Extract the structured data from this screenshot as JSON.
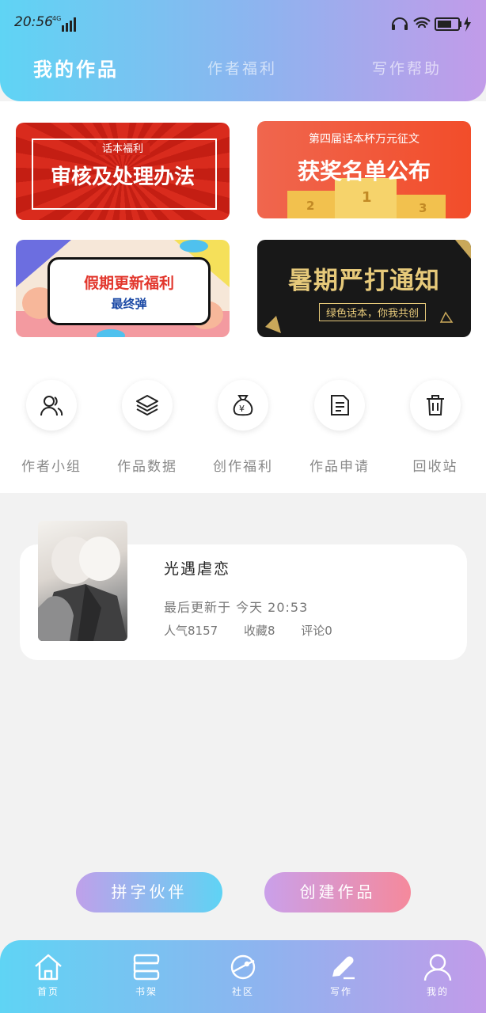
{
  "status_bar": {
    "time": "20:56",
    "network": "4G"
  },
  "header_tabs": [
    {
      "label": "我的作品",
      "active": true
    },
    {
      "label": "作者福利",
      "active": false
    },
    {
      "label": "写作帮助",
      "active": false
    }
  ],
  "banners": [
    {
      "small": "话本福利",
      "big": "审核及处理办法"
    },
    {
      "small": "第四届话本杯万元征文",
      "big": "获奖名单公布",
      "podium": [
        "2",
        "1",
        "3"
      ]
    },
    {
      "big": "假期更新福利",
      "small": "最终弹"
    },
    {
      "big": "暑期严打通知",
      "small": "绿色话本，你我共创"
    }
  ],
  "tools": [
    {
      "label": "作者小组",
      "icon": "users-icon"
    },
    {
      "label": "作品数据",
      "icon": "layers-icon"
    },
    {
      "label": "创作福利",
      "icon": "money-bag-icon"
    },
    {
      "label": "作品申请",
      "icon": "document-icon"
    },
    {
      "label": "回收站",
      "icon": "trash-icon"
    }
  ],
  "work": {
    "title": "光遇虐恋",
    "updated": "最后更新于 今天 20:53",
    "popularity": "人气8157",
    "favorites": "收藏8",
    "comments": "评论0"
  },
  "buttons": {
    "partner": "拼字伙伴",
    "create": "创建作品"
  },
  "nav": [
    {
      "label": "首页",
      "icon": "home-icon"
    },
    {
      "label": "书架",
      "icon": "bookshelf-icon"
    },
    {
      "label": "社区",
      "icon": "planet-icon"
    },
    {
      "label": "写作",
      "icon": "pen-icon"
    },
    {
      "label": "我的",
      "icon": "user-icon"
    }
  ],
  "colors": {
    "gradient_start": "#5fd4f4",
    "gradient_end": "#c29be9",
    "background": "#f2f2f2"
  }
}
